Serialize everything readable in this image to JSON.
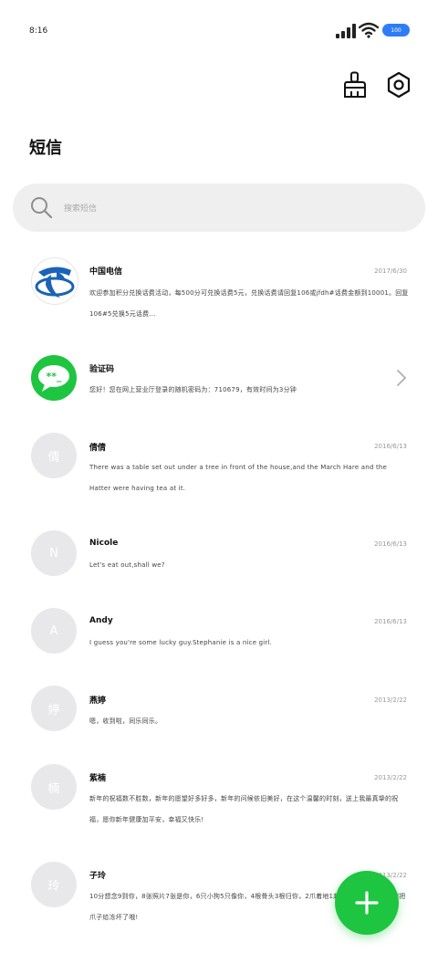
{
  "status_bar": {
    "time": "8:16",
    "battery": "100"
  },
  "header": {
    "title": "短信",
    "clean_icon": "broom-icon",
    "settings_icon": "gear-icon"
  },
  "search": {
    "placeholder": "搜索短信"
  },
  "messages": [
    {
      "name": "中国电信",
      "date": "2017/6/30",
      "text": "欢迎参加积分兑换话费活动，每500分可兑换话费5元，兑换话费请回复106或jfdh#话费金额到10001。回复106#5兑换5元话费..."
    },
    {
      "name": "验证码",
      "date": "",
      "text": "您好！您在网上营业厅登录的随机密码为：710679，有效时间为3分钟",
      "avatar_text": "**_"
    },
    {
      "name": "倩倩",
      "date": "2016/6/13",
      "text": "There was a table set out under a tree in front of the house,and the March Hare and the Hatter were having tea at it.",
      "avatar_text": "倩"
    },
    {
      "name": "Nicole",
      "date": "2016/6/13",
      "text": "Let's eat out,shall we?",
      "avatar_text": "N"
    },
    {
      "name": "Andy",
      "date": "2016/6/13",
      "text": "I guess you're some lucky guy.Stephanie is a nice girl.",
      "avatar_text": "A"
    },
    {
      "name": "燕婷",
      "date": "2013/2/22",
      "text": "嗯，收到啦，同乐同乐。",
      "avatar_text": "婷"
    },
    {
      "name": "紫楠",
      "date": "2013/2/22",
      "text": "新年的祝福数不胜数，新年的愿望好多好多，新年的问候依旧美好，在这个温馨的时刻，送上我最真挚的祝福，愿你新年健康加平安，幸福又快乐!",
      "avatar_text": "楠"
    },
    {
      "name": "子玲",
      "date": "2013/2/22",
      "text": "10分想念9到你，8张照片7张是你，6只小狗5只像你，4根骨头3根归你，2爪着地1起来记得盖好被子，别把爪子给冻坏了哦!",
      "avatar_text": "玲"
    }
  ],
  "colors": {
    "accent": "#1ec540",
    "telecom_blue": "#1a63b6",
    "avatar_grey": "#e8e8ea",
    "battery": "#2f7df6"
  },
  "fab": {
    "icon": "plus-icon"
  }
}
